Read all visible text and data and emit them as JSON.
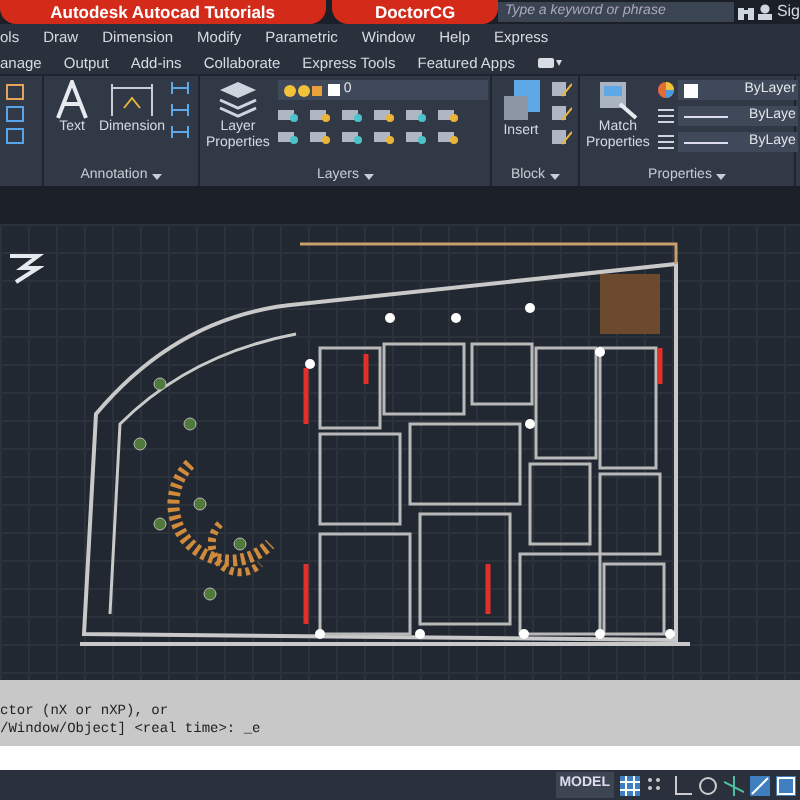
{
  "header_tabs": [
    {
      "label": "Autodesk Autocad Tutorials"
    },
    {
      "label": "DoctorCG"
    }
  ],
  "search": {
    "placeholder": "Type a keyword or phrase"
  },
  "user": {
    "label": "Sig"
  },
  "menu": [
    "ols",
    "Draw",
    "Dimension",
    "Modify",
    "Parametric",
    "Window",
    "Help",
    "Express"
  ],
  "ribbon_tabs": [
    "anage",
    "Output",
    "Add-ins",
    "Collaborate",
    "Express Tools",
    "Featured Apps"
  ],
  "panels": [
    {
      "title": "Annotation",
      "tools": [
        {
          "label": "Text"
        },
        {
          "label": "Dimension"
        }
      ]
    },
    {
      "title": "Layers",
      "tools": [
        {
          "label": "Layer Properties"
        }
      ],
      "layer": "0"
    },
    {
      "title": "Block",
      "tools": [
        {
          "label": "Insert"
        }
      ]
    },
    {
      "title": "Properties",
      "tools": [
        {
          "label": "Match Properties"
        }
      ],
      "dropdowns": [
        "ByLayer",
        "ByLaye",
        "ByLaye"
      ]
    }
  ],
  "command_history": [
    "ctor (nX or nXP), or",
    "/Window/Object] <real time>: _e"
  ],
  "status_bar": {
    "mode": "MODEL"
  }
}
